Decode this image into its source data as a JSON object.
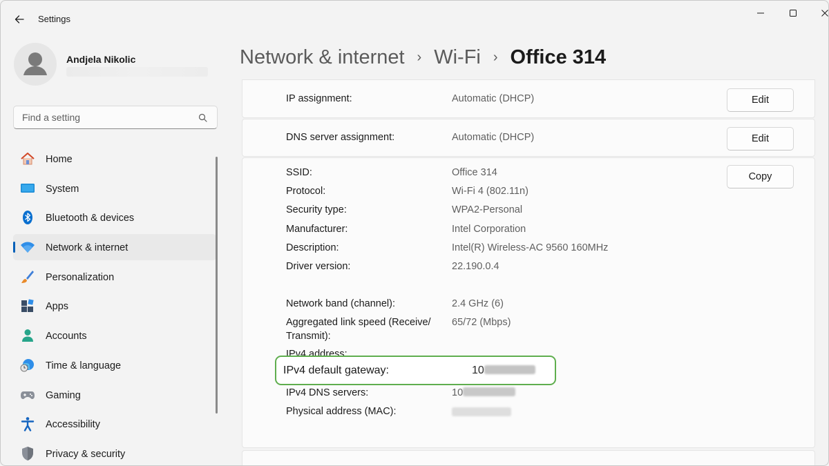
{
  "app": {
    "title": "Settings"
  },
  "user": {
    "name": "Andjela Nikolic"
  },
  "search": {
    "placeholder": "Find a setting",
    "value": ""
  },
  "nav": {
    "items": [
      {
        "label": "Home",
        "icon": "home-icon",
        "active": false
      },
      {
        "label": "System",
        "icon": "monitor-icon",
        "active": false
      },
      {
        "label": "Bluetooth & devices",
        "icon": "bluetooth-icon",
        "active": false
      },
      {
        "label": "Network & internet",
        "icon": "wifi-icon",
        "active": true
      },
      {
        "label": "Personalization",
        "icon": "brush-icon",
        "active": false
      },
      {
        "label": "Apps",
        "icon": "apps-icon",
        "active": false
      },
      {
        "label": "Accounts",
        "icon": "person-icon",
        "active": false
      },
      {
        "label": "Time & language",
        "icon": "globe-clock-icon",
        "active": false
      },
      {
        "label": "Gaming",
        "icon": "gamepad-icon",
        "active": false
      },
      {
        "label": "Accessibility",
        "icon": "accessibility-icon",
        "active": false
      },
      {
        "label": "Privacy & security",
        "icon": "shield-icon",
        "active": false
      }
    ]
  },
  "breadcrumb": {
    "items": [
      "Network & internet",
      "Wi-Fi",
      "Office 314"
    ],
    "separator": "›"
  },
  "ip_assignment": {
    "label": "IP assignment:",
    "value": "Automatic (DHCP)",
    "button": "Edit"
  },
  "dns_assignment": {
    "label": "DNS server assignment:",
    "value": "Automatic (DHCP)",
    "button": "Edit"
  },
  "properties": {
    "copy_button": "Copy",
    "ssid": {
      "label": "SSID:",
      "value": "Office 314"
    },
    "protocol": {
      "label": "Protocol:",
      "value": "Wi-Fi 4 (802.11n)"
    },
    "security": {
      "label": "Security type:",
      "value": "WPA2-Personal"
    },
    "manufacturer": {
      "label": "Manufacturer:",
      "value": "Intel Corporation"
    },
    "description": {
      "label": "Description:",
      "value": "Intel(R) Wireless-AC 9560 160MHz"
    },
    "driver": {
      "label": "Driver version:",
      "value": "22.190.0.4"
    },
    "band": {
      "label": "Network band (channel):",
      "value": "2.4 GHz (6)"
    },
    "link_speed": {
      "label_line1": "Aggregated link speed (Receive/",
      "label_line2": "Transmit):",
      "value": "65/72 (Mbps)"
    },
    "ipv4_address": {
      "label": "IPv4 address:"
    },
    "ipv4_gateway": {
      "label": "IPv4 default gateway:",
      "value_prefix": "10"
    },
    "ipv4_dns": {
      "label": "IPv4 DNS servers:",
      "value_prefix": "10"
    },
    "mac": {
      "label": "Physical address (MAC):"
    }
  },
  "colors": {
    "accent": "#005fb8",
    "highlight_border": "#5fae4e"
  }
}
